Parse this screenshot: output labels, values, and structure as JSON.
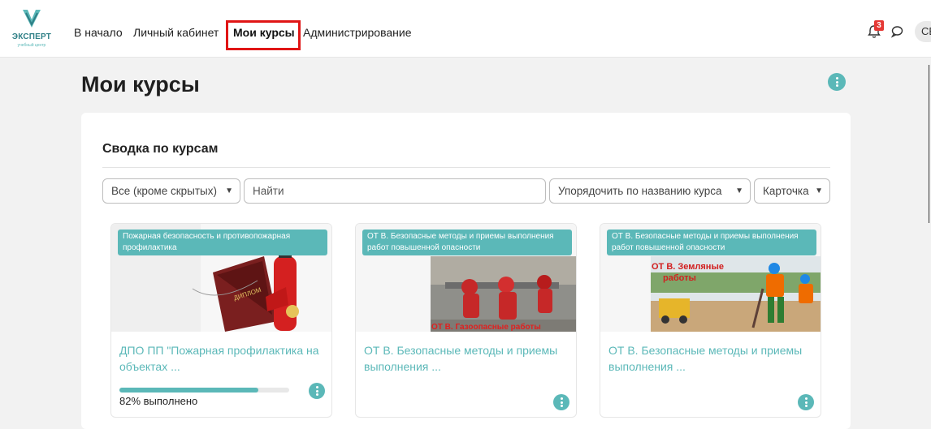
{
  "logo": {
    "brand": "ЭКСПЕРТ",
    "subtitle": "учебный центр"
  },
  "nav": {
    "items": [
      {
        "label": "В начало"
      },
      {
        "label": "Личный кабинет"
      },
      {
        "label": "Мои курсы",
        "active": true
      },
      {
        "label": "Администрирование"
      }
    ]
  },
  "header": {
    "notifications_count": "3",
    "notification_icon": "bell-icon",
    "message_icon": "chat-bubble-icon",
    "avatar_initials": "СЕ"
  },
  "page": {
    "title": "Мои курсы"
  },
  "overview": {
    "title": "Сводка по курсам",
    "filter": "Все (кроме скрытых)",
    "search_placeholder": "Найти",
    "sort": "Упорядочить по названию курса",
    "view": "Карточка"
  },
  "courses": [
    {
      "category": "Пожарная безопасность и противопожарная профилактика",
      "name": "ДПО ПП \"Пожарная профилактика на объектах ...",
      "progress": 82,
      "progress_text": "82% выполнено",
      "image_caption": "ДИПЛОМ"
    },
    {
      "category": "ОТ В. Безопасные методы и приемы выполнения работ повышенной опасности",
      "name": "ОТ В. Безопасные методы и приемы выполнения ...",
      "image_caption": "ОТ В. Газоопасные работы"
    },
    {
      "category": "ОТ В. Безопасные методы и приемы выполнения работ повышенной опасности",
      "name": "ОТ В. Безопасные методы и приемы выполнения ...",
      "image_caption_line1": "ОТ В. Земляные",
      "image_caption_line2": "работы"
    }
  ],
  "colors": {
    "accent": "#5bb8b8",
    "highlight": "#e01515",
    "badge": "#e53935"
  }
}
